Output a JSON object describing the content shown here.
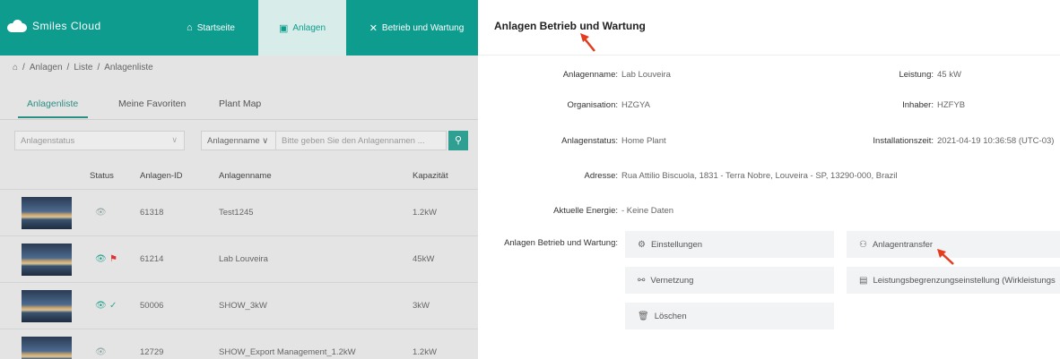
{
  "app": {
    "brand": "Smiles Cloud"
  },
  "topnav": {
    "home": {
      "label": "Startseite",
      "icon": "home-icon"
    },
    "anlagen": {
      "label": "Anlagen",
      "icon": "plant-icon"
    },
    "betrieb": {
      "label": "Betrieb und Wartung",
      "icon": "tools-icon"
    }
  },
  "breadcrumb": {
    "home_icon": "home-icon",
    "items": [
      "Anlagen",
      "Liste",
      "Anlagenliste"
    ],
    "separator": "/"
  },
  "tabs": [
    "Anlagenliste",
    "Meine Favoriten",
    "Plant Map"
  ],
  "filters": {
    "status_placeholder": "Anlagenstatus",
    "name_select": "Anlagenname",
    "search_placeholder": "Bitte geben Sie den Anlagennamen ..."
  },
  "table": {
    "columns": [
      "Status",
      "Anlagen-ID",
      "Anlagenname",
      "Kapazität"
    ],
    "rows": [
      {
        "id": "61318",
        "name": "Test1245",
        "capacity": "1.2kW"
      },
      {
        "id": "61214",
        "name": "Lab Louveira",
        "capacity": "45kW"
      },
      {
        "id": "50006",
        "name": "SHOW_3kW",
        "capacity": "3kW"
      },
      {
        "id": "12729",
        "name": "SHOW_Export Management_1.2kW",
        "capacity": "1.2kW"
      }
    ]
  },
  "panel": {
    "title": "Anlagen Betrieb und Wartung",
    "fields": {
      "anlagenname": {
        "label": "Anlagenname:",
        "value": "Lab Louveira"
      },
      "leistung": {
        "label": "Leistung:",
        "value": "45 kW"
      },
      "organisation": {
        "label": "Organisation:",
        "value": "HZGYA"
      },
      "inhaber": {
        "label": "Inhaber:",
        "value": "HZFYB"
      },
      "status": {
        "label": "Anlagenstatus:",
        "value": "Home Plant"
      },
      "installationszeit": {
        "label": "Installationszeit:",
        "value": "2021-04-19 10:36:58 (UTC-03)"
      },
      "adresse": {
        "label": "Adresse:",
        "value": "Rua Attilio Biscuola, 1831 - Terra Nobre, Louveira - SP, 13290-000, Brazil"
      },
      "energie": {
        "label": "Aktuelle Energie:",
        "value": "- Keine Daten"
      },
      "betrieb": {
        "label": "Anlagen Betrieb und Wartung:"
      }
    },
    "options": {
      "einstellungen": "Einstellungen",
      "anlagentransfer": "Anlagentransfer",
      "vernetzung": "Vernetzung",
      "leistungsbegrenzung": "Leistungsbegrenzungseinstellung (Wirkleistungs",
      "loeschen": "Löschen"
    }
  },
  "colors": {
    "brand": "#0e9c8e",
    "accent": "#2c8f83",
    "arrow": "#e53b1f"
  }
}
